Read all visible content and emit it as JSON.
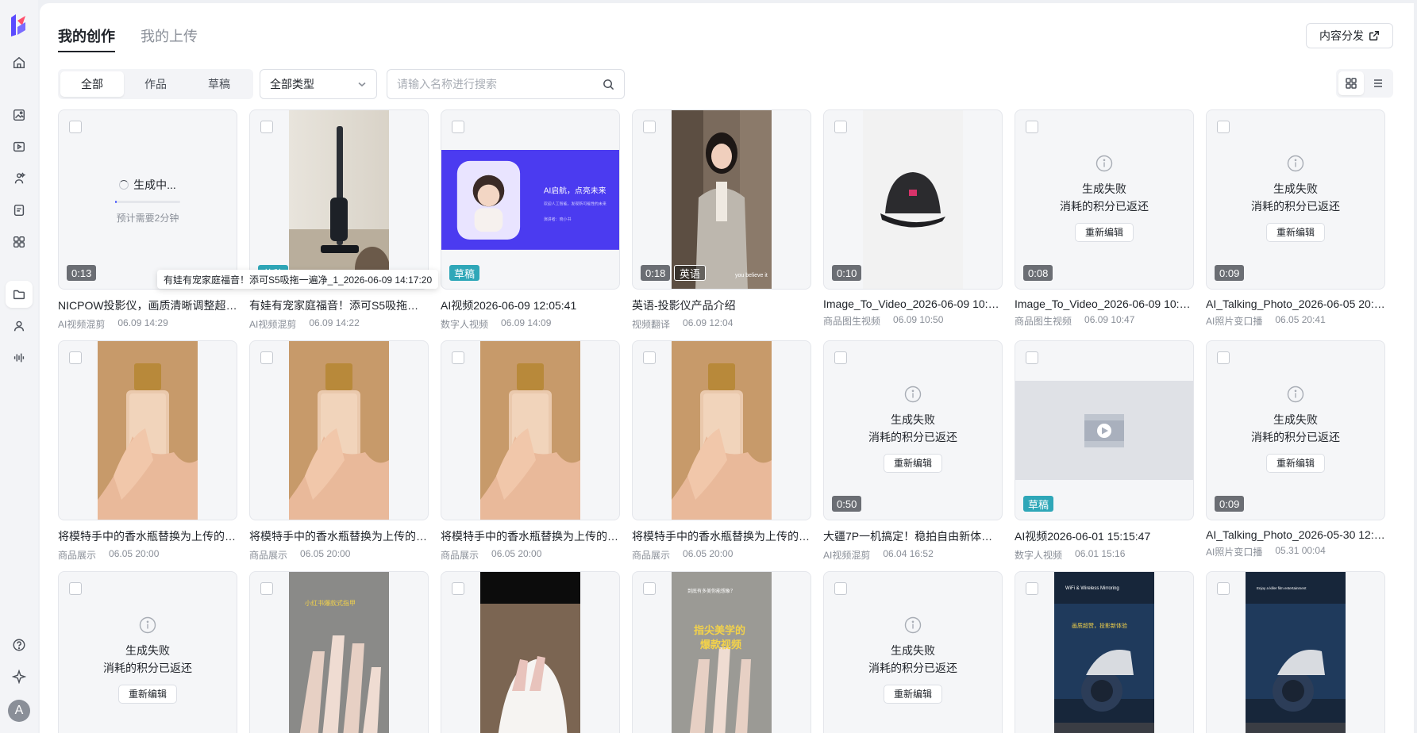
{
  "nav": {
    "items": [
      {
        "name": "home-icon"
      },
      {
        "name": "image-gen-icon"
      },
      {
        "name": "video-gen-icon"
      },
      {
        "name": "digital-human-icon"
      },
      {
        "name": "product-icon"
      },
      {
        "name": "apps-grid-icon"
      },
      {
        "name": "folder-icon",
        "active": true
      },
      {
        "name": "user-icon"
      },
      {
        "name": "audio-icon"
      }
    ],
    "bottom": [
      {
        "name": "help-icon"
      },
      {
        "name": "sparkle-icon"
      }
    ],
    "avatar_letter": "A"
  },
  "header": {
    "tabs": [
      {
        "label": "我的创作",
        "active": true
      },
      {
        "label": "我的上传",
        "active": false
      }
    ],
    "publish_label": "内容分发"
  },
  "toolbar": {
    "filters": [
      {
        "label": "全部",
        "active": true
      },
      {
        "label": "作品",
        "active": false
      },
      {
        "label": "草稿",
        "active": false
      }
    ],
    "type_select": "全部类型",
    "search_placeholder": "请输入名称进行搜索"
  },
  "tooltip": "有娃有宠家庭福音！添可S5吸拖一遍净_1_2026-06-09 14:17:20",
  "status": {
    "generating": "生成中...",
    "eta": "预计需要2分钟",
    "fail_line1": "生成失败",
    "fail_line2": "消耗的积分已返还",
    "redo": "重新编辑"
  },
  "cards": [
    {
      "kind": "generating",
      "progress": 0.03,
      "duration": "0:13",
      "title": "NICPOW投影仪，画质清晰调整超出预期",
      "category": "AI视频混剪",
      "time": "06.09 14:29"
    },
    {
      "kind": "image",
      "scene": "vacuum",
      "badge": "草稿",
      "title": "有娃有宠家庭福音！添可S5吸拖一遍净",
      "category": "AI视频混剪",
      "time": "06.09 14:22"
    },
    {
      "kind": "image",
      "scene": "banner",
      "badge": "草稿",
      "banner_title": "AI启航，点亮未来",
      "banner_sub": "欢迎人工智能，发现新可能性的未来",
      "banner_name": "演讲者：晓小书",
      "title": "AI视频2026-06-09 12:05:41",
      "category": "数字人视频",
      "time": "06.09 14:09"
    },
    {
      "kind": "image",
      "scene": "presenter",
      "duration": "0:18",
      "lang": "英语",
      "caption": "you believe it",
      "title": "英语-投影仪产品介绍",
      "category": "视频翻译",
      "time": "06.09 12:04"
    },
    {
      "kind": "image",
      "scene": "cap",
      "duration": "0:10",
      "title": "Image_To_Video_2026-06-09 10:50:12",
      "category": "商品图生视频",
      "time": "06.09 10:50"
    },
    {
      "kind": "failed",
      "duration": "0:08",
      "title": "Image_To_Video_2026-06-09 10:47:33",
      "category": "商品图生视频",
      "time": "06.09 10:47"
    },
    {
      "kind": "failed",
      "duration": "0:09",
      "title": "AI_Talking_Photo_2026-06-05 20:41:18",
      "category": "AI照片变口播",
      "time": "06.05 20:41"
    },
    {
      "kind": "image",
      "scene": "bottle",
      "title": "将模特手中的香水瓶替换为上传的产品图片",
      "category": "商品展示",
      "time": "06.05 20:00"
    },
    {
      "kind": "image",
      "scene": "bottle",
      "title": "将模特手中的香水瓶替换为上传的产品图片",
      "category": "商品展示",
      "time": "06.05 20:00"
    },
    {
      "kind": "image",
      "scene": "bottle",
      "title": "将模特手中的香水瓶替换为上传的产品图片",
      "category": "商品展示",
      "time": "06.05 20:00"
    },
    {
      "kind": "image",
      "scene": "bottle",
      "title": "将模特手中的香水瓶替换为上传的产品图片",
      "category": "商品展示",
      "time": "06.05 20:00"
    },
    {
      "kind": "failed",
      "duration": "0:50",
      "title": "大疆7P一机搞定！稳拍自由新体验，出片超快",
      "category": "AI视频混剪",
      "time": "06.04 16:52"
    },
    {
      "kind": "placeholder",
      "badge": "草稿",
      "title": "AI视频2026-06-01 15:15:47",
      "category": "数字人视频",
      "time": "06.01 15:16"
    },
    {
      "kind": "failed",
      "duration": "0:09",
      "title": "AI_Talking_Photo_2026-05-30 12:00:04",
      "category": "AI照片变口播",
      "time": "05.31 00:04"
    },
    {
      "kind": "failed",
      "title": "",
      "category": "",
      "time": ""
    },
    {
      "kind": "image",
      "scene": "nails1",
      "overlay": "小红书爆款式指甲",
      "title": "",
      "category": "",
      "time": ""
    },
    {
      "kind": "image",
      "scene": "nails2",
      "title": "",
      "category": "",
      "time": ""
    },
    {
      "kind": "image",
      "scene": "nails3",
      "overlay_top": "到底有多美你能想象？",
      "overlay": "指尖美学的",
      "overlay2": "爆款视频",
      "title": "",
      "category": "",
      "time": ""
    },
    {
      "kind": "failed",
      "title": "",
      "category": "",
      "time": ""
    },
    {
      "kind": "image",
      "scene": "moto",
      "overlay_top": "WiFi & Wireless Mirroring",
      "overlay": "画质超赞，投影新体验",
      "title": "",
      "category": "",
      "time": ""
    },
    {
      "kind": "image",
      "scene": "moto2",
      "overlay_top": "Enjoy a killer film entertainment",
      "title": "",
      "category": "",
      "time": ""
    }
  ],
  "colors": {
    "accent": "#4b5bff",
    "draft_badge": "#2fa7b8",
    "border": "#e4e6eb"
  }
}
